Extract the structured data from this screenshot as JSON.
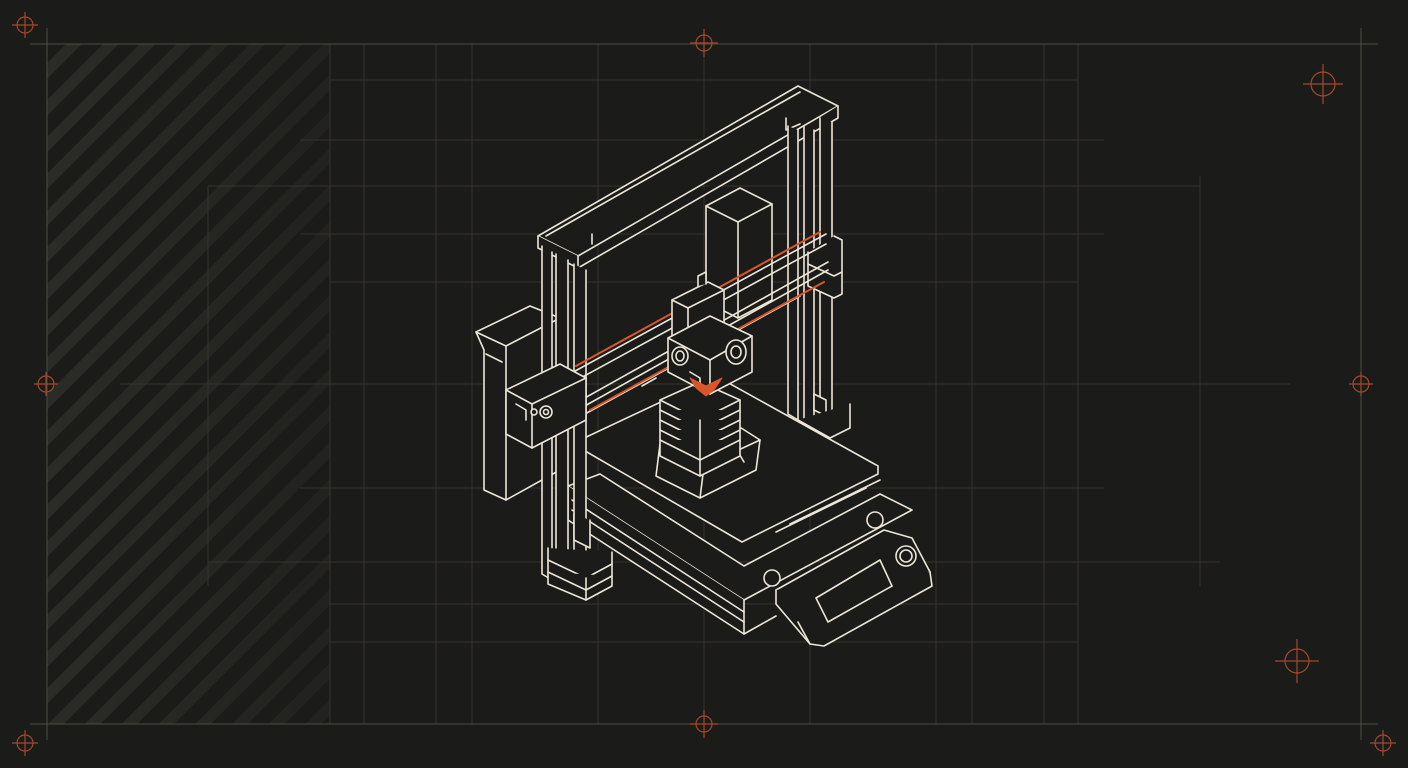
{
  "scene": {
    "subject": "printer-3d-icon",
    "colors": {
      "background": "#1b1b1a",
      "line": "#ece6d6",
      "accent": "#d9562a",
      "grid": "#3a3a34",
      "frame": "#55524a",
      "hatch": "#2c2c28"
    }
  }
}
